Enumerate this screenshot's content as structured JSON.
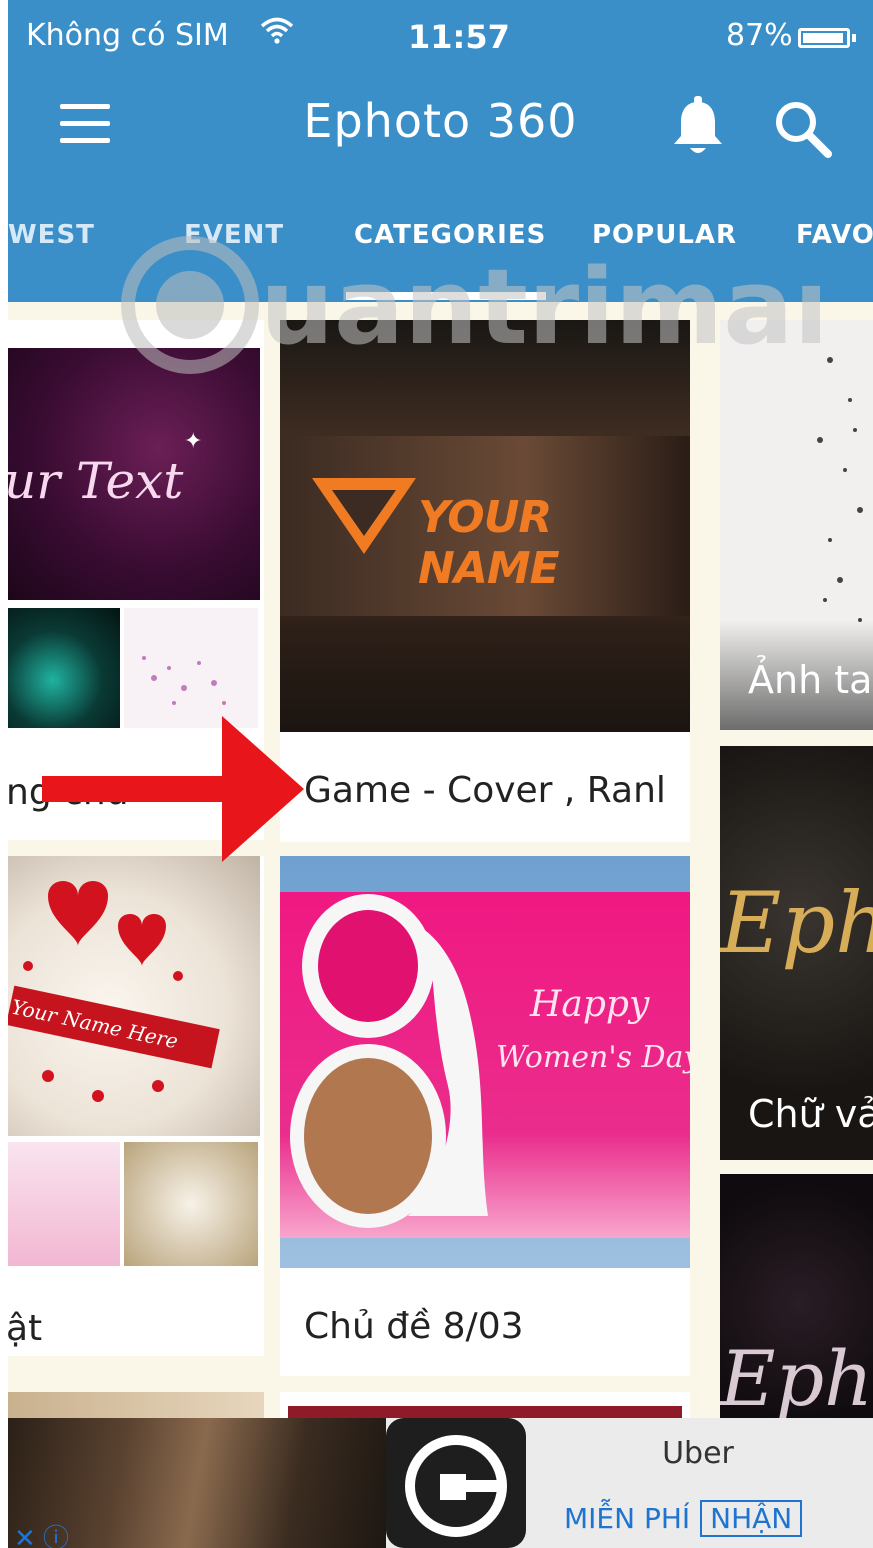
{
  "status_bar": {
    "carrier": "Không có SIM",
    "wifi_icon": "wifi-icon",
    "time": "11:57",
    "battery": "87%"
  },
  "header": {
    "title": "Ephoto 360",
    "menu_icon": "hamburger-icon",
    "bell_icon": "bell-icon",
    "search_icon": "search-icon"
  },
  "tabs": [
    {
      "label": "WEST"
    },
    {
      "label": "EVENT"
    },
    {
      "label": "CATEGORIES",
      "selected": true
    },
    {
      "label": "POPULAR"
    },
    {
      "label": "FAVO"
    }
  ],
  "watermark": "uantrimang",
  "cards": [
    {
      "label": "ng chữ",
      "thumb_text": "ur Text"
    },
    {
      "label": "Game - Cover  , Ranl",
      "thumb_text": "YOUR NAME"
    },
    {
      "overlay": "Ảnh ta"
    },
    {
      "overlay": "Chữ vả",
      "thumb_text": "Eph"
    },
    {
      "label": "ật",
      "thumb_text": "Your Name Here"
    },
    {
      "label": "Chủ đề 8/03",
      "thumb_text_1": "Happy",
      "thumb_text_2": "Women's Day"
    },
    {
      "thumb_text": "Epho"
    }
  ],
  "ad": {
    "brand": "Uber",
    "cta_text": "MIỄN PHÍ",
    "cta_button": "NHẬN",
    "close_icon": "close-icon",
    "info_icon": "info-icon"
  },
  "colors": {
    "accent": "#3a8fc9",
    "content_bg": "#fbf7e8",
    "arrow": "#e8151b",
    "ad_link": "#1f74d1"
  }
}
